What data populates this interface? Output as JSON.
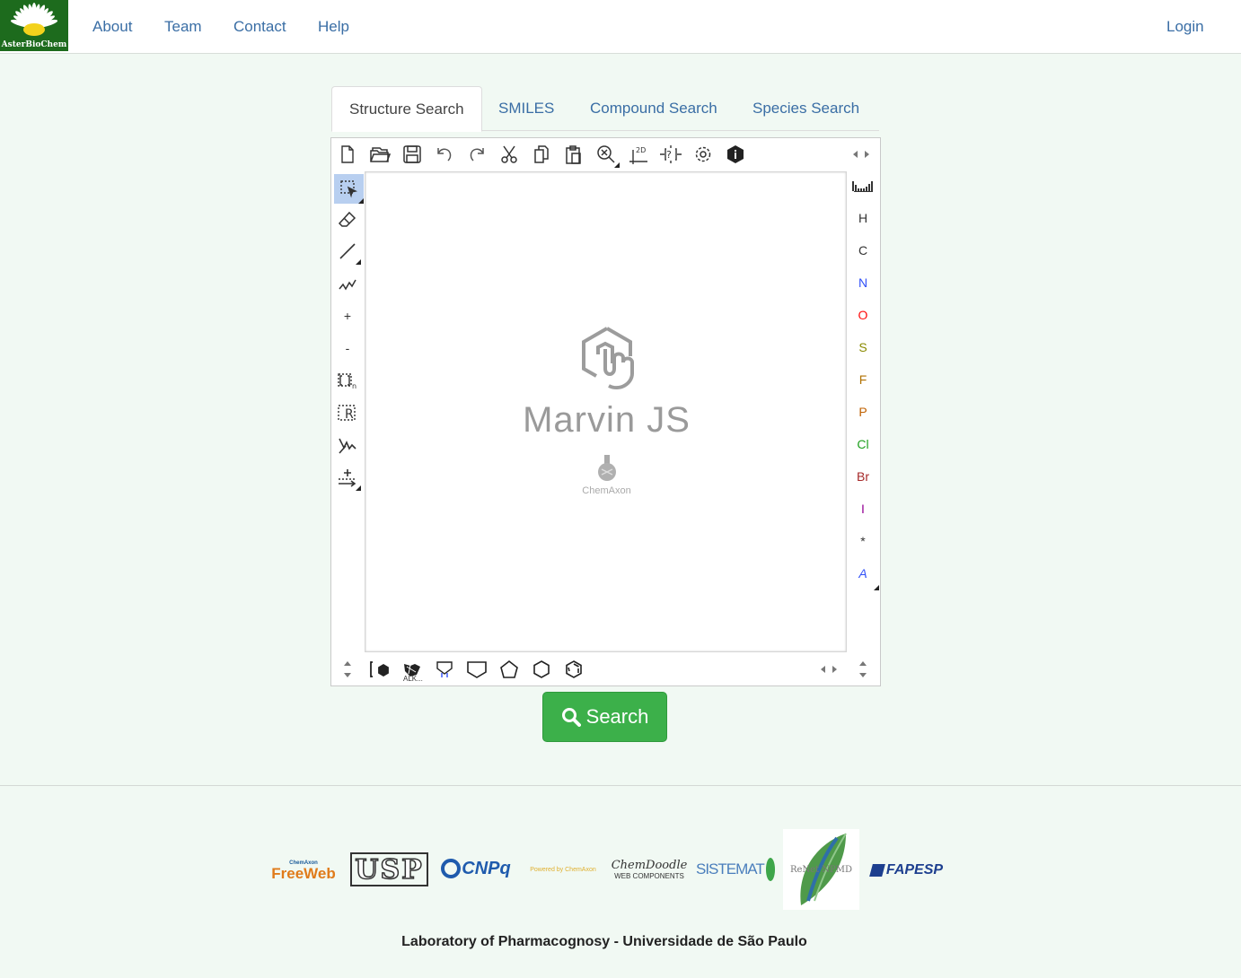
{
  "header": {
    "logo_text": "AsterBioChem",
    "nav": {
      "about": "About",
      "team": "Team",
      "contact": "Contact",
      "help": "Help",
      "login": "Login"
    }
  },
  "tabs": {
    "structure": "Structure Search",
    "smiles": "SMILES",
    "compound": "Compound Search",
    "species": "Species Search"
  },
  "editor": {
    "watermark_title": "Marvin JS",
    "watermark_vendor": "ChemAxon",
    "top_toolbar": [
      "new-document-icon",
      "open-file-icon",
      "save-icon",
      "undo-icon",
      "redo-icon",
      "cut-icon",
      "copy-icon",
      "paste-icon",
      "zoom-clear-icon",
      "clean-2d-icon",
      "query-icon",
      "settings-icon",
      "info-icon"
    ],
    "elements": {
      "periodic": "periodic-table-icon",
      "h": "H",
      "c": "C",
      "n": "N",
      "o": "O",
      "s": "S",
      "f": "F",
      "p": "P",
      "cl": "Cl",
      "br": "Br",
      "i": "I",
      "any": "*",
      "atom_list": "A"
    },
    "element_colors": {
      "H": "#333333",
      "C": "#333333",
      "N": "#3050f8",
      "O": "#ff0d0d",
      "S": "#8a8a00",
      "F": "#b07000",
      "P": "#c06000",
      "Cl": "#1fa01f",
      "Br": "#a62929",
      "I": "#940094",
      "*": "#333333",
      "A": "#3050f8"
    },
    "left_tools": {
      "charge_plus": "+",
      "charge_minus": "-"
    },
    "bottom_template_label": "ALK..."
  },
  "search_button": "Search",
  "partners": {
    "freeweb_small": "ChemAxon",
    "freeweb": "FreeWeb",
    "usp": "USP",
    "cnpq": "CNPq",
    "chemaxon_small": "Powered by ChemAxon",
    "chemdoodle_top": "ChemDoodle",
    "chemdoodle_bottom": "WEB COMPONENTS",
    "sistemat": "SISTEMAT",
    "renetnpmd": "ReNet NPMD",
    "fapesp": "FAPESP"
  },
  "footer": {
    "text": "Laboratory of Pharmacognosy - Universidade de São Paulo"
  }
}
